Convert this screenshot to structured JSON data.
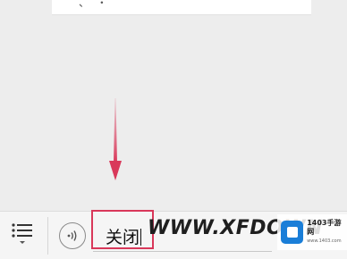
{
  "top_bubble": {
    "partial_text": "、  ・"
  },
  "input_bar": {
    "menu_icon": "list-menu-icon",
    "voice_icon": "voice-wave-icon",
    "text_value": "关闭"
  },
  "overlay": {
    "watermark": "WWW.XFDOWN",
    "badge_text": "1403手游网",
    "badge_sub": "www.1403.com",
    "arrow_color": "#d9385a",
    "highlight_color": "#d9385a"
  }
}
